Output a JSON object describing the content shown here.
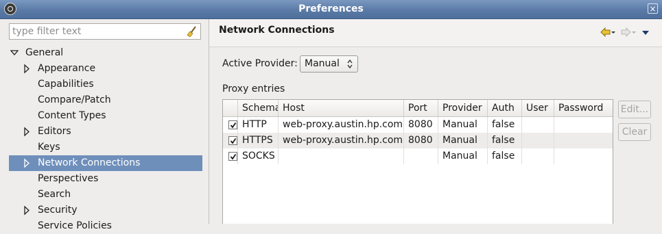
{
  "window": {
    "title": "Preferences",
    "close_glyph": "×"
  },
  "filter": {
    "placeholder": "type filter text",
    "value": ""
  },
  "tree": [
    {
      "label": "General",
      "expander": "open",
      "level": 0
    },
    {
      "label": "Appearance",
      "expander": "closed",
      "level": 1
    },
    {
      "label": "Capabilities",
      "expander": "none",
      "level": 1
    },
    {
      "label": "Compare/Patch",
      "expander": "none",
      "level": 1
    },
    {
      "label": "Content Types",
      "expander": "none",
      "level": 1
    },
    {
      "label": "Editors",
      "expander": "closed",
      "level": 1
    },
    {
      "label": "Keys",
      "expander": "none",
      "level": 1
    },
    {
      "label": "Network Connections",
      "expander": "closed",
      "level": 1,
      "selected": true
    },
    {
      "label": "Perspectives",
      "expander": "none",
      "level": 1
    },
    {
      "label": "Search",
      "expander": "none",
      "level": 1
    },
    {
      "label": "Security",
      "expander": "closed",
      "level": 1
    },
    {
      "label": "Service Policies",
      "expander": "none",
      "level": 1
    }
  ],
  "page": {
    "title": "Network Connections"
  },
  "provider": {
    "label": "Active Provider:",
    "value": "Manual"
  },
  "proxy": {
    "label": "Proxy entries",
    "columns": [
      "Schema",
      "Host",
      "Port",
      "Provider",
      "Auth",
      "User",
      "Password"
    ],
    "rows": [
      {
        "checked": true,
        "schema": "HTTP",
        "host": "web-proxy.austin.hp.com",
        "port": "8080",
        "provider": "Manual",
        "auth": "false",
        "user": "",
        "password": ""
      },
      {
        "checked": true,
        "schema": "HTTPS",
        "host": "web-proxy.austin.hp.com",
        "port": "8080",
        "provider": "Manual",
        "auth": "false",
        "user": "",
        "password": ""
      },
      {
        "checked": true,
        "schema": "SOCKS",
        "host": "",
        "port": "",
        "provider": "Manual",
        "auth": "false",
        "user": "",
        "password": ""
      }
    ]
  },
  "buttons": {
    "edit": "Edit...",
    "clear": "Clear"
  },
  "colors": {
    "titlebar": "#5b7aa6",
    "selection": "#6f8fbb",
    "nav_arrow": "#d4a017"
  },
  "icons": [
    "app-icon",
    "close-icon",
    "broom-icon",
    "back-arrow-icon",
    "forward-arrow-icon",
    "view-menu-icon",
    "updown-icon",
    "checkbox-icon"
  ]
}
